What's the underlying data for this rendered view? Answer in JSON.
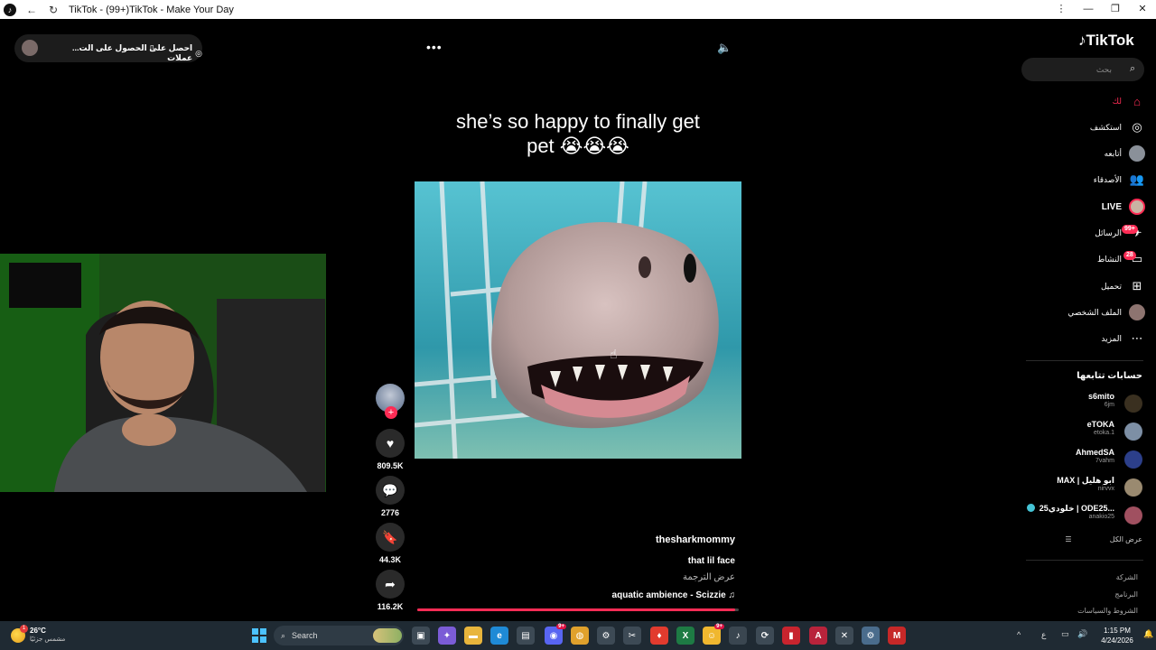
{
  "window": {
    "title": "TikTok - (99+)TikTok - Make Your Day",
    "minimize": "—",
    "maximize": "❐",
    "close": "✕",
    "menu": "⋮"
  },
  "top_pill": {
    "get_coins": "احصل على عملات",
    "get_app": "الحصول على الت..."
  },
  "video": {
    "caption_line1": "she’s so happy to finally get",
    "caption_line2": "pet 😭😭😭",
    "author": "thesharkmommy",
    "description": "that lil face",
    "translate": "عرض الترجمة",
    "music": "aquatic ambience - Scizzie",
    "progress_fraction": 0.99
  },
  "actions": {
    "likes": "809.5K",
    "comments": "2776",
    "saves": "44.3K",
    "shares": "116.2K"
  },
  "sidebar": {
    "logo": "TikTok",
    "search_placeholder": "بحث",
    "nav": [
      {
        "label": "لك"
      },
      {
        "label": "استكشف"
      },
      {
        "label": "أتابعه"
      },
      {
        "label": "الأصدقاء"
      },
      {
        "label": "LIVE"
      },
      {
        "label": "الرسائل",
        "badge": "99+"
      },
      {
        "label": "النشاط",
        "badge": "28"
      },
      {
        "label": "تحميل"
      },
      {
        "label": "الملف الشخصي"
      },
      {
        "label": "المزيد"
      }
    ],
    "following_header": "حسابات تتابعها",
    "accounts": [
      {
        "name": "s6mito",
        "handle": "6jm"
      },
      {
        "name": "eTOKA",
        "handle": "etoka.1"
      },
      {
        "name": "AhmedSA",
        "handle": "7vahm"
      },
      {
        "name": "MAX | ابو هليل",
        "handle": "nirvvx"
      },
      {
        "name": "خلودي25 | ODE25...",
        "handle": "anakio25"
      }
    ],
    "see_all": "عرض الكل",
    "footer": [
      "الشركة",
      "البرنامج",
      "الشروط والسياسات"
    ]
  },
  "taskbar": {
    "temperature": "26°C",
    "weather_desc": "مشمس جزئيًا",
    "weather_badge": "1",
    "search_label": "Search",
    "discord_badge": "9+",
    "chat_badge": "9+",
    "lang": "ع",
    "time": "1:15 PM",
    "date": "4/24/2026"
  },
  "colors": {
    "accent": "#fe2c55",
    "taskbar": "#1f2a33",
    "background": "#000000"
  }
}
